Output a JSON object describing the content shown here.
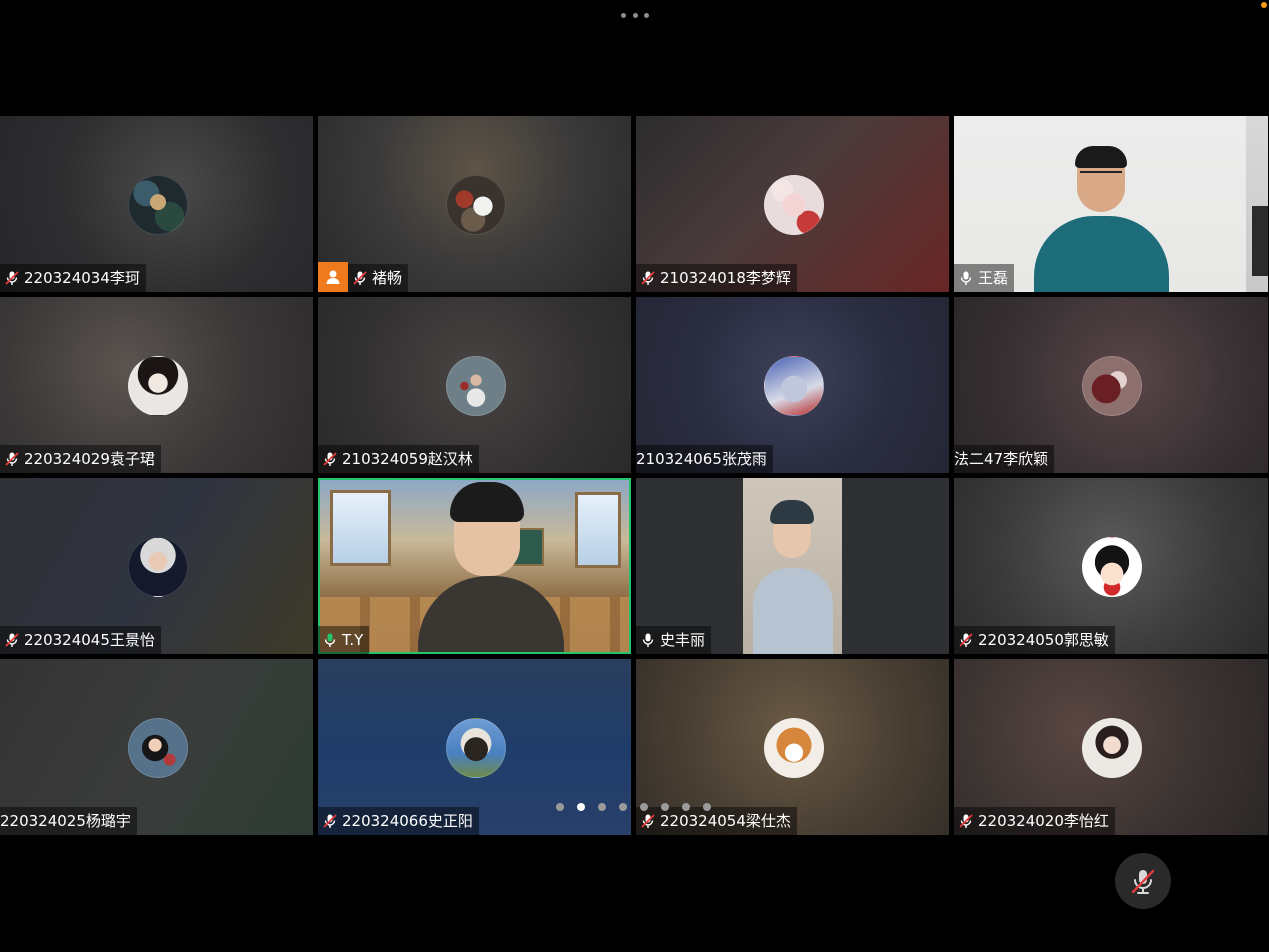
{
  "colors": {
    "background": "#000000",
    "active_speaker_border": "#23c46a",
    "host_badge": "#f07b1f",
    "mute_slash": "#e23b3b",
    "mic_active": "#23c46a",
    "notification_dot": "#f29a1a"
  },
  "participants": [
    {
      "name": "220324034李珂",
      "mic": "muted",
      "view": "avatar"
    },
    {
      "name": "褚畅",
      "mic": "muted",
      "view": "avatar",
      "host": true
    },
    {
      "name": "210324018李梦辉",
      "mic": "muted",
      "view": "avatar"
    },
    {
      "name": "王磊",
      "mic": "on",
      "view": "video"
    },
    {
      "name": "220324029袁子珺",
      "mic": "muted",
      "view": "avatar"
    },
    {
      "name": "210324059赵汉林",
      "mic": "muted",
      "view": "avatar"
    },
    {
      "name": "210324065张茂雨",
      "mic": "none",
      "view": "avatar"
    },
    {
      "name": "法二47李欣颖",
      "mic": "none",
      "view": "avatar"
    },
    {
      "name": "220324045王景怡",
      "mic": "muted",
      "view": "avatar"
    },
    {
      "name": "T.Y",
      "mic": "speaking",
      "view": "video",
      "active": true
    },
    {
      "name": "史丰丽",
      "mic": "on",
      "view": "video"
    },
    {
      "name": "220324050郭思敏",
      "mic": "muted",
      "view": "avatar"
    },
    {
      "name": "220324025杨璐宇",
      "mic": "none",
      "view": "avatar"
    },
    {
      "name": "220324066史正阳",
      "mic": "muted",
      "view": "avatar"
    },
    {
      "name": "220324054梁仕杰",
      "mic": "muted",
      "view": "avatar"
    },
    {
      "name": "220324020李怡红",
      "mic": "muted",
      "view": "avatar"
    }
  ],
  "pagination": {
    "total_pages": 8,
    "current_page": 2
  },
  "icons": {
    "more": "more-dots-icon",
    "muted": "mic-muted-icon",
    "mic_on": "mic-icon",
    "speaking": "mic-speaking-icon",
    "host": "host-person-icon",
    "self_mic": "mic-muted-icon"
  }
}
